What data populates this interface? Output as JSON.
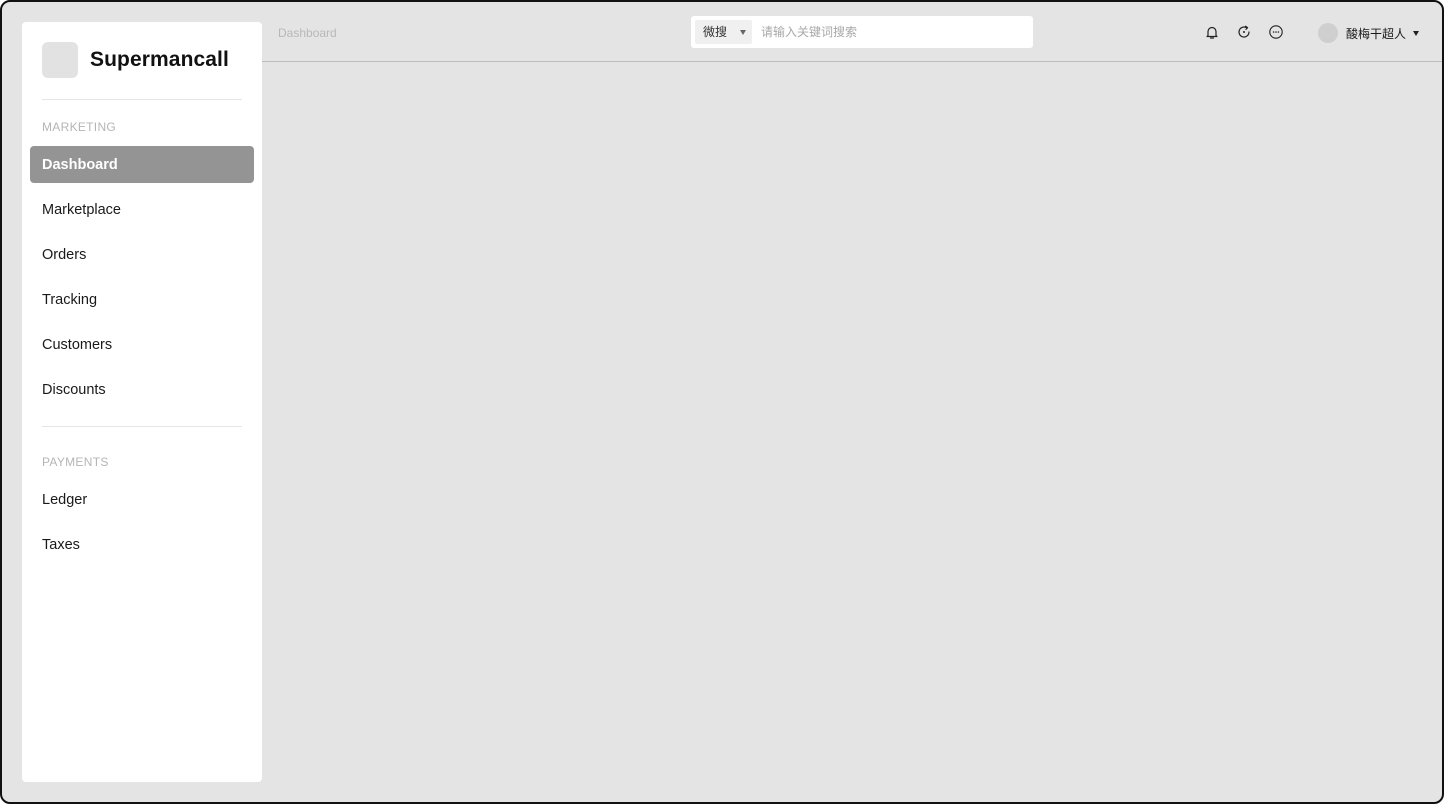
{
  "sidebar": {
    "brand": "Supermancall",
    "sections": [
      {
        "label": "MARKETING",
        "items": [
          {
            "label": "Dashboard",
            "active": true
          },
          {
            "label": "Marketplace"
          },
          {
            "label": "Orders"
          },
          {
            "label": "Tracking"
          },
          {
            "label": "Customers"
          },
          {
            "label": "Discounts"
          }
        ]
      },
      {
        "label": "PAYMENTS",
        "items": [
          {
            "label": "Ledger"
          },
          {
            "label": "Taxes"
          }
        ]
      }
    ]
  },
  "header": {
    "breadcrumb": "Dashboard",
    "search": {
      "type_label": "微搜",
      "placeholder": "请输入关键词搜索",
      "value": ""
    },
    "icons": [
      "bell-icon",
      "refresh-icon",
      "more-icon"
    ],
    "user": {
      "name": "酸梅干超人"
    }
  }
}
